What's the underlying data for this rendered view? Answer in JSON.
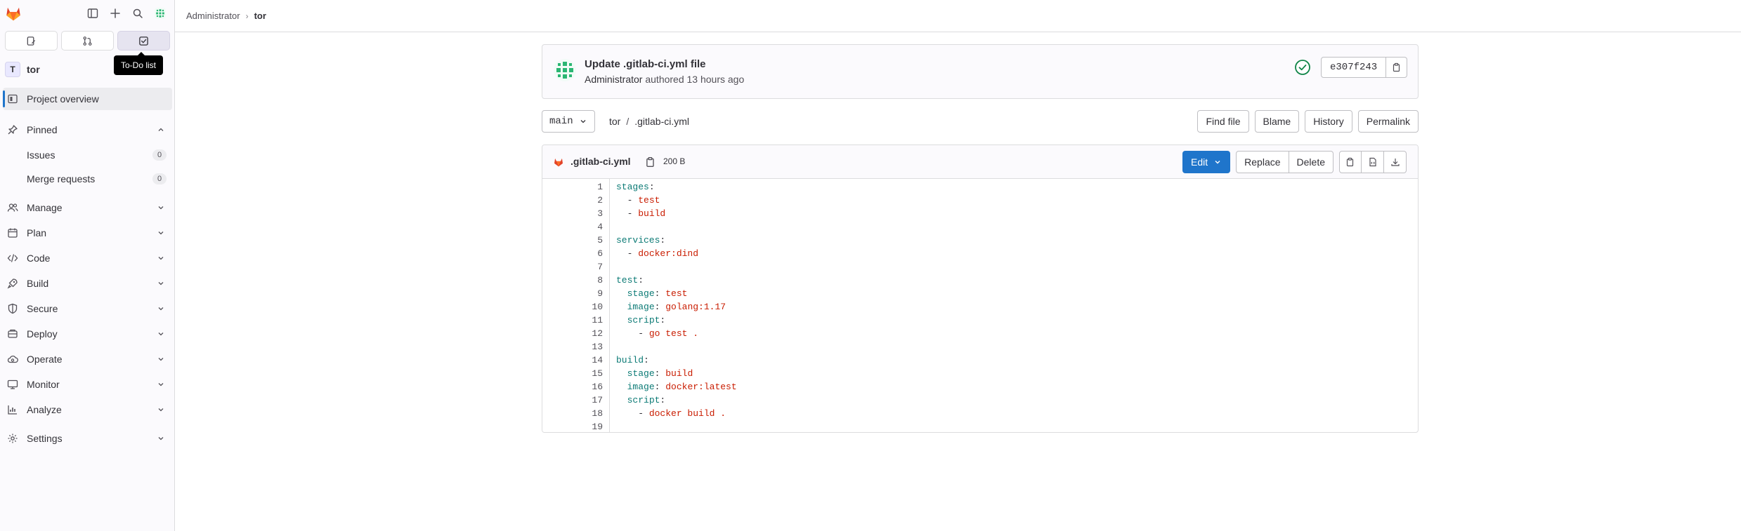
{
  "sidebar": {
    "tooltip": "To-Do list",
    "project": {
      "avatar_letter": "T",
      "name": "tor"
    },
    "overview_label": "Project overview",
    "pinned": {
      "label": "Pinned",
      "items": [
        {
          "label": "Issues",
          "count": "0"
        },
        {
          "label": "Merge requests",
          "count": "0"
        }
      ]
    },
    "sections": [
      {
        "label": "Manage",
        "icon": "users-icon"
      },
      {
        "label": "Plan",
        "icon": "planning-icon"
      },
      {
        "label": "Code",
        "icon": "code-icon"
      },
      {
        "label": "Build",
        "icon": "rocket-icon"
      },
      {
        "label": "Secure",
        "icon": "shield-icon"
      },
      {
        "label": "Deploy",
        "icon": "deployments-icon"
      },
      {
        "label": "Operate",
        "icon": "cloud-gear-icon"
      },
      {
        "label": "Monitor",
        "icon": "monitor-icon"
      },
      {
        "label": "Analyze",
        "icon": "chart-icon"
      }
    ],
    "settings_label": "Settings"
  },
  "breadcrumb": {
    "parent": "Administrator",
    "separator": "›",
    "current": "tor"
  },
  "commit": {
    "title": "Update .gitlab-ci.yml file",
    "author": "Administrator",
    "meta_suffix": "authored 13 hours ago",
    "sha": "e307f243",
    "status_color": "#108548"
  },
  "tree": {
    "branch": "main",
    "path_root": "tor",
    "path_sep": "/",
    "path_file": ".gitlab-ci.yml",
    "actions": {
      "find": "Find file",
      "blame": "Blame",
      "history": "History",
      "permalink": "Permalink"
    }
  },
  "file": {
    "name": ".gitlab-ci.yml",
    "size": "200 B",
    "edit_label": "Edit",
    "replace_label": "Replace",
    "delete_label": "Delete",
    "lines": [
      [
        [
          "k",
          "stages"
        ],
        [
          "p",
          ":"
        ]
      ],
      [
        [
          "p",
          "  - "
        ],
        [
          "s",
          "test"
        ]
      ],
      [
        [
          "p",
          "  - "
        ],
        [
          "s",
          "build"
        ]
      ],
      [],
      [
        [
          "k",
          "services"
        ],
        [
          "p",
          ":"
        ]
      ],
      [
        [
          "p",
          "  - "
        ],
        [
          "s",
          "docker:dind"
        ]
      ],
      [],
      [
        [
          "k",
          "test"
        ],
        [
          "p",
          ":"
        ]
      ],
      [
        [
          "p",
          "  "
        ],
        [
          "k",
          "stage"
        ],
        [
          "p",
          ": "
        ],
        [
          "s",
          "test"
        ]
      ],
      [
        [
          "p",
          "  "
        ],
        [
          "k",
          "image"
        ],
        [
          "p",
          ": "
        ],
        [
          "s",
          "golang:1.17"
        ]
      ],
      [
        [
          "p",
          "  "
        ],
        [
          "k",
          "script"
        ],
        [
          "p",
          ":"
        ]
      ],
      [
        [
          "p",
          "    - "
        ],
        [
          "s",
          "go test ."
        ]
      ],
      [],
      [
        [
          "k",
          "build"
        ],
        [
          "p",
          ":"
        ]
      ],
      [
        [
          "p",
          "  "
        ],
        [
          "k",
          "stage"
        ],
        [
          "p",
          ": "
        ],
        [
          "s",
          "build"
        ]
      ],
      [
        [
          "p",
          "  "
        ],
        [
          "k",
          "image"
        ],
        [
          "p",
          ": "
        ],
        [
          "s",
          "docker:latest"
        ]
      ],
      [
        [
          "p",
          "  "
        ],
        [
          "k",
          "script"
        ],
        [
          "p",
          ":"
        ]
      ],
      [
        [
          "p",
          "    - "
        ],
        [
          "s",
          "docker build ."
        ]
      ],
      []
    ]
  },
  "colors": {
    "accent": "#1f75cb",
    "brand": "#e24329",
    "avatar": "#2bb673"
  }
}
